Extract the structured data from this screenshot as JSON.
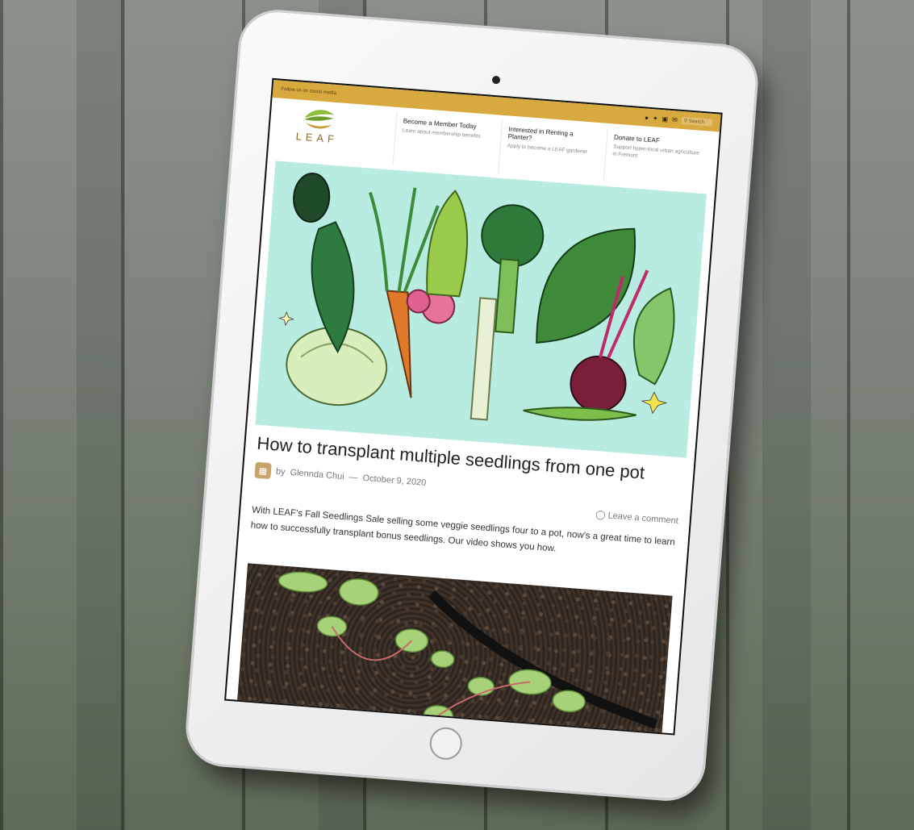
{
  "site": {
    "topbar_text": "Follow us on social media",
    "search_placeholder": "Search",
    "logo_text": "LEAF"
  },
  "nav": [
    {
      "title": "Become a Member Today",
      "desc": "Learn about membership benefits."
    },
    {
      "title": "Interested in Renting a Planter?",
      "desc": "Apply to become a LEAF gardener"
    },
    {
      "title": "Donate to LEAF",
      "desc": "Support hyper-local urban agriculture in Fremont"
    }
  ],
  "article": {
    "title": "How to transplant multiple seedlings from one pot",
    "byline_prefix": "by",
    "author": "Glennda Chui",
    "separator": "—",
    "date": "October 9, 2020",
    "comment_label": "Leave a comment",
    "intro": "With LEAF's Fall Seedlings Sale selling some veggie seedlings four to a pot, now's a great time to learn how to successfully transplant bonus seedlings. Our video shows you how."
  },
  "icons": {
    "social": [
      "facebook-icon",
      "twitter-icon",
      "instagram-icon",
      "email-icon",
      "search-icon"
    ],
    "comment": "comment-icon"
  },
  "colors": {
    "topbar": "#d7a93e",
    "hero_bg": "#b9ece0",
    "logo_green": "#8bbf3c",
    "logo_gold": "#c99a3b"
  }
}
